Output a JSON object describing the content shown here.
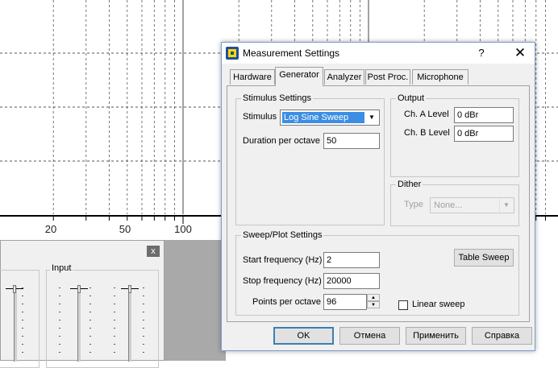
{
  "graph": {
    "x_tick_labels": [
      {
        "label": "20",
        "value": 20
      },
      {
        "label": "50",
        "value": 50
      },
      {
        "label": "100",
        "value": 100
      }
    ]
  },
  "mixer": {
    "close_label": "x",
    "input_group_label": "Input"
  },
  "dialog": {
    "title": "Measurement Settings",
    "help_label": "?",
    "close_label": "✕",
    "tabs": [
      {
        "label": "Hardware",
        "active": false
      },
      {
        "label": "Generator",
        "active": true
      },
      {
        "label": "Analyzer",
        "active": false
      },
      {
        "label": "Post Proc.",
        "active": false
      },
      {
        "label": "Microphone",
        "active": false
      }
    ],
    "stimulus_settings": {
      "group_label": "Stimulus Settings",
      "stimulus_label": "Stimulus",
      "stimulus_value": "Log Sine Sweep",
      "duration_label": "Duration per octave",
      "duration_value": "50"
    },
    "output": {
      "group_label": "Output",
      "ch_a_label": "Ch. A Level",
      "ch_a_value": "0 dBr",
      "ch_b_label": "Ch. B Level",
      "ch_b_value": "0 dBr"
    },
    "dither": {
      "group_label": "Dither",
      "type_label": "Type",
      "type_value": "None..."
    },
    "sweep_plot": {
      "group_label": "Sweep/Plot Settings",
      "start_label": "Start frequency (Hz)",
      "start_value": "2",
      "stop_label": "Stop frequency (Hz)",
      "stop_value": "20000",
      "points_label": "Points per octave",
      "points_value": "96",
      "table_sweep_label": "Table Sweep",
      "linear_sweep_label": "Linear sweep",
      "linear_sweep_checked": false
    },
    "buttons": {
      "ok": "OK",
      "cancel": "Отмена",
      "apply": "Применить",
      "help": "Справка"
    }
  },
  "colors": {
    "selection": "#3b8ee3",
    "dialog_border": "#7a9ccf",
    "default_button_border": "#3c7fb1"
  }
}
